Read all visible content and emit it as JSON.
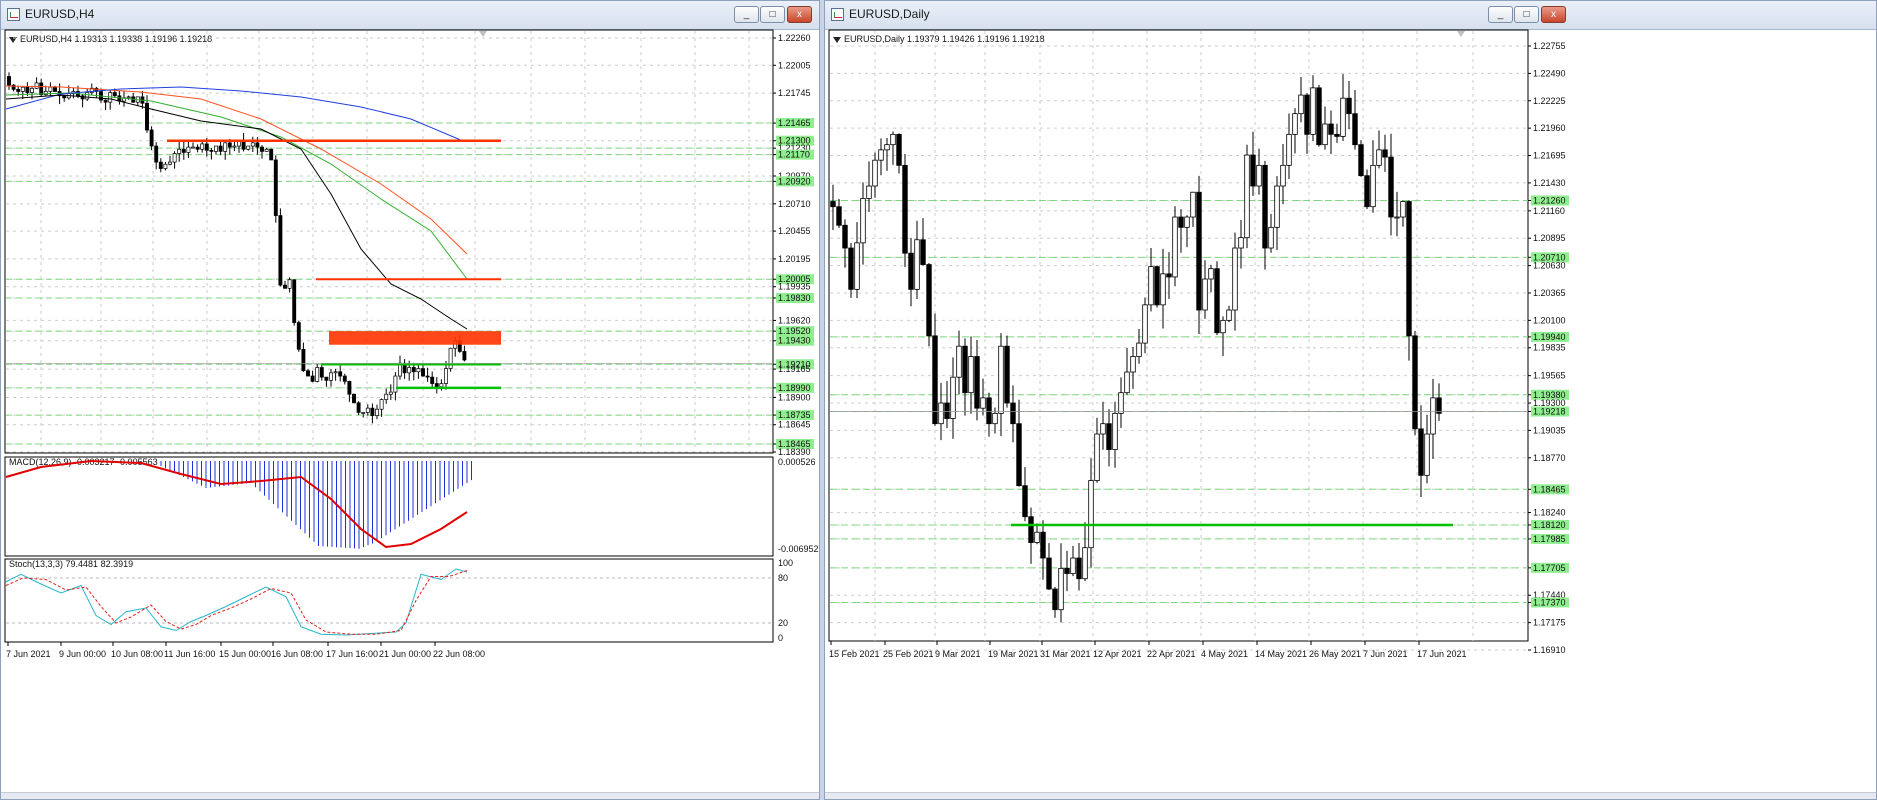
{
  "left_window": {
    "title": "EURUSD,H4",
    "info": "EURUSD,H4  1.19313 1.19338 1.19196 1.19218",
    "price_labels": [
      "1.22260",
      "1.22005",
      "1.21745",
      "1.21465",
      "1.21300",
      "1.21230",
      "1.21170",
      "1.20970",
      "1.20920",
      "1.20710",
      "1.20455",
      "1.20195",
      "1.20005",
      "1.19935",
      "1.19830",
      "1.19620",
      "1.19520",
      "1.19430",
      "1.19210",
      "1.19165",
      "1.18990",
      "1.18900",
      "1.18735",
      "1.18645",
      "1.18465",
      "1.18390"
    ],
    "time_labels": [
      "7 Jun 2021",
      "9 Jun 00:00",
      "10 Jun 08:00",
      "11 Jun 16:00",
      "15 Jun 00:00",
      "16 Jun 08:00",
      "17 Jun 16:00",
      "21 Jun 00:00",
      "22 Jun 08:00"
    ],
    "macd": {
      "label": "MACD(12,26,9) -0.003217 -0.005563",
      "top": "0.000526",
      "bottom": "-0.006952"
    },
    "stoch": {
      "label": "Stoch(13,3,3) 79.4481 82.3919",
      "level_high": "100",
      "level_80": "80",
      "level_20": "20",
      "level_low": "0"
    }
  },
  "right_window": {
    "title": "EURUSD,Daily",
    "info": "EURUSD,Daily  1.19379 1.19426 1.19196 1.19218",
    "price_labels": [
      "1.22755",
      "1.22490",
      "1.22225",
      "1.21960",
      "1.21695",
      "1.21430",
      "1.21260",
      "1.21160",
      "1.20895",
      "1.20710",
      "1.20630",
      "1.20365",
      "1.20100",
      "1.19940",
      "1.19835",
      "1.19565",
      "1.19380",
      "1.19300",
      "1.19218",
      "1.19035",
      "1.18770",
      "1.18465",
      "1.18240",
      "1.18120",
      "1.17985",
      "1.17705",
      "1.17440",
      "1.17370",
      "1.17175",
      "1.16910"
    ],
    "time_labels": [
      "15 Feb 2021",
      "25 Feb 2021",
      "9 Mar 2021",
      "19 Mar 2021",
      "31 Mar 2021",
      "12 Apr 2021",
      "22 Apr 2021",
      "4 May 2021",
      "14 May 2021",
      "26 May 2021",
      "7 Jun 2021",
      "17 Jun 2021"
    ]
  },
  "window_buttons": {
    "minimize": "_",
    "maximize": "□",
    "close": "x"
  },
  "colors": {
    "bull": "#ffffff",
    "bear": "#000000",
    "green_level": "#00c000",
    "red_level": "#ff3300",
    "ma_blue": "#2040e0",
    "ma_red": "#ff5020",
    "ma_green": "#30b030",
    "ma_black": "#000000",
    "label_bg": "#90ee90",
    "grid": "#c8d0c8"
  }
}
